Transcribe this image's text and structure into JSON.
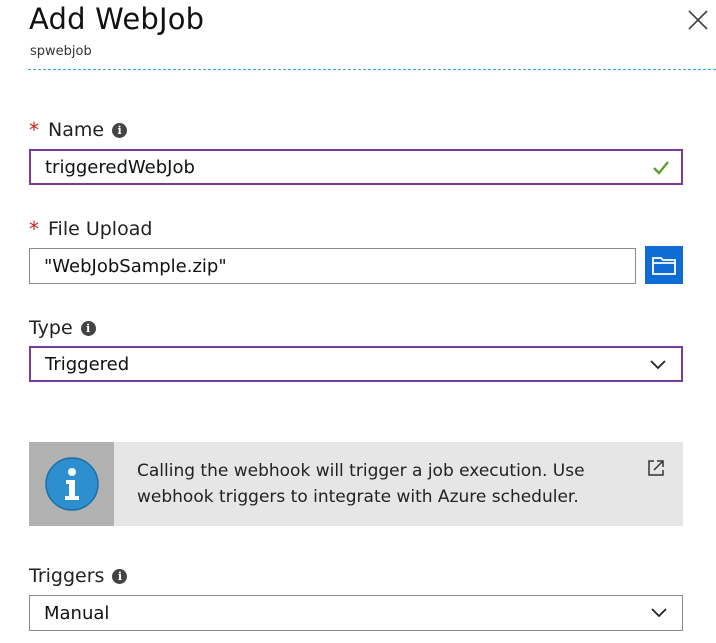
{
  "header": {
    "title": "Add WebJob",
    "subtitle": "spwebjob"
  },
  "fields": {
    "name": {
      "required_mark": "*",
      "label": "Name",
      "value": "triggeredWebJob"
    },
    "file_upload": {
      "required_mark": "*",
      "label": "File Upload",
      "value": "\"WebJobSample.zip\""
    },
    "type": {
      "label": "Type",
      "value": "Triggered"
    },
    "triggers": {
      "label": "Triggers",
      "value": "Manual"
    }
  },
  "info_box": {
    "text": "Calling the webhook will trigger a job execution. Use webhook triggers to integrate with Azure scheduler."
  },
  "icons": {
    "close": "close-icon",
    "info": "info-icon",
    "check": "checkmark-icon",
    "folder": "folder-icon",
    "chevron": "chevron-down-icon",
    "external_link": "external-link-icon"
  },
  "colors": {
    "accent_purple": "#7a3b9c",
    "required_red": "#d02020",
    "valid_green": "#5aa02c",
    "button_blue": "#0f6cd4",
    "divider_blue": "#3ea6d4",
    "info_circle_blue": "#2e8fd0"
  }
}
